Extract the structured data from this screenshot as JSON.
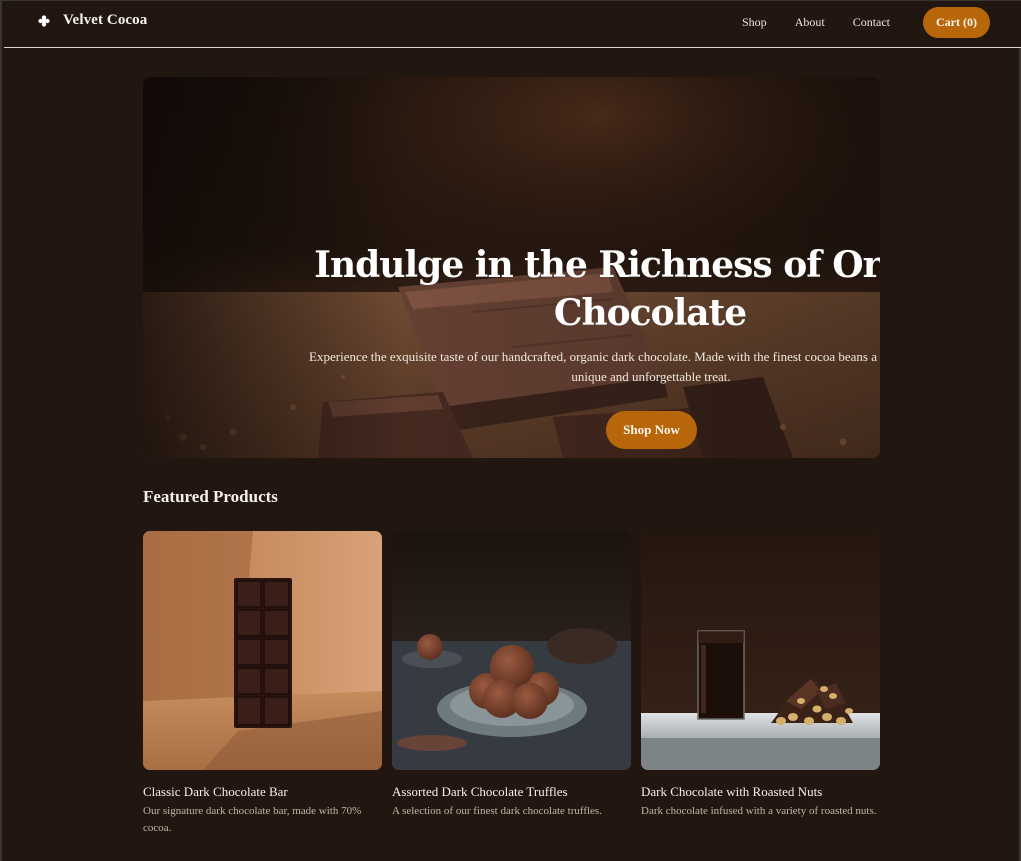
{
  "header": {
    "brand_name": "Velvet Cocoa",
    "nav": {
      "shop": "Shop",
      "about": "About",
      "contact": "Contact"
    },
    "cart_label": "Cart (0)"
  },
  "hero": {
    "title": "Indulge in the Richness of Organic Chocolate",
    "subtitle": "Experience the exquisite taste of our handcrafted, organic dark chocolate. Made with the finest cocoa beans a our chocolate offers a unique and unforgettable treat.",
    "cta_label": "Shop Now"
  },
  "featured": {
    "title": "Featured Products",
    "products": [
      {
        "name": "Classic Dark Chocolate Bar",
        "description": "Our signature dark chocolate bar, made with 70% cocoa."
      },
      {
        "name": "Assorted Dark Chocolate Truffles",
        "description": "A selection of our finest dark chocolate truffles."
      },
      {
        "name": "Dark Chocolate with Roasted Nuts",
        "description": "Dark chocolate infused with a variety of roasted nuts."
      }
    ]
  },
  "colors": {
    "background": "#221710",
    "accent": "#b8660a",
    "text": "#f3ece4",
    "muted_text": "#c3b3a5"
  },
  "icons": {
    "brand": "flower-icon"
  }
}
